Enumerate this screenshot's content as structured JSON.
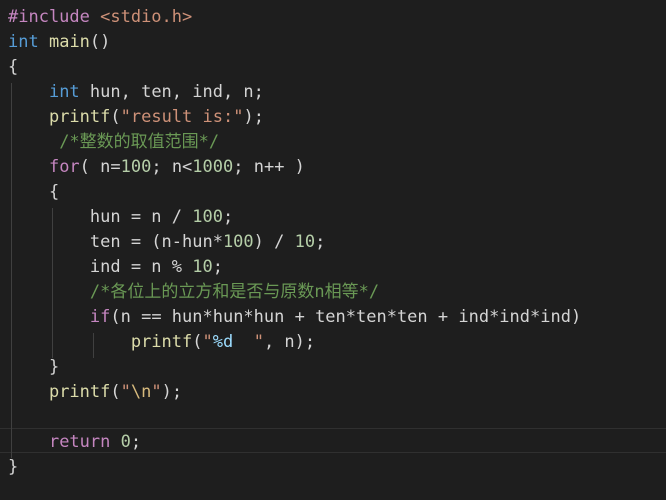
{
  "editor": {
    "theme": "dark",
    "background": "#1e1e1e",
    "colors": {
      "preprocessor": "#c586c0",
      "keyword_type": "#569cd6",
      "keyword_control": "#c586c0",
      "function": "#dcdcaa",
      "string": "#ce9178",
      "number": "#b5cea8",
      "comment": "#6a9955",
      "text": "#d4d4d4"
    },
    "lines": [
      [
        {
          "t": "#include ",
          "c": "kw-pre"
        },
        {
          "t": "<stdio.h>",
          "c": "str"
        }
      ],
      [
        {
          "t": "int",
          "c": "kw-type"
        },
        {
          "t": " ",
          "c": "plain"
        },
        {
          "t": "main",
          "c": "fn"
        },
        {
          "t": "()",
          "c": "plain"
        }
      ],
      [
        {
          "t": "{",
          "c": "plain"
        }
      ],
      [
        {
          "t": "    ",
          "c": "plain"
        },
        {
          "t": "int",
          "c": "kw-type"
        },
        {
          "t": " hun, ten, ind, n;",
          "c": "plain"
        }
      ],
      [
        {
          "t": "    ",
          "c": "plain"
        },
        {
          "t": "printf",
          "c": "fn"
        },
        {
          "t": "(",
          "c": "plain"
        },
        {
          "t": "\"result is:\"",
          "c": "str"
        },
        {
          "t": ");",
          "c": "plain"
        }
      ],
      [
        {
          "t": "     ",
          "c": "plain"
        },
        {
          "t": "/*整数的取值范围*/",
          "c": "com"
        }
      ],
      [
        {
          "t": "    ",
          "c": "plain"
        },
        {
          "t": "for",
          "c": "kw-ctrl"
        },
        {
          "t": "( n=",
          "c": "plain"
        },
        {
          "t": "100",
          "c": "num"
        },
        {
          "t": "; n<",
          "c": "plain"
        },
        {
          "t": "1000",
          "c": "num"
        },
        {
          "t": "; n++ )",
          "c": "plain"
        }
      ],
      [
        {
          "t": "    {",
          "c": "plain"
        }
      ],
      [
        {
          "t": "        hun = n / ",
          "c": "plain"
        },
        {
          "t": "100",
          "c": "num"
        },
        {
          "t": ";",
          "c": "plain"
        }
      ],
      [
        {
          "t": "        ten = (n-hun*",
          "c": "plain"
        },
        {
          "t": "100",
          "c": "num"
        },
        {
          "t": ") / ",
          "c": "plain"
        },
        {
          "t": "10",
          "c": "num"
        },
        {
          "t": ";",
          "c": "plain"
        }
      ],
      [
        {
          "t": "        ind = n % ",
          "c": "plain"
        },
        {
          "t": "10",
          "c": "num"
        },
        {
          "t": ";",
          "c": "plain"
        }
      ],
      [
        {
          "t": "        ",
          "c": "plain"
        },
        {
          "t": "/*各位上的立方和是否与原数n相等*/",
          "c": "com"
        }
      ],
      [
        {
          "t": "        ",
          "c": "plain"
        },
        {
          "t": "if",
          "c": "kw-ctrl"
        },
        {
          "t": "(n == hun*hun*hun + ten*ten*ten + ind*ind*ind)",
          "c": "plain"
        }
      ],
      [
        {
          "t": "            ",
          "c": "plain"
        },
        {
          "t": "printf",
          "c": "fn"
        },
        {
          "t": "(",
          "c": "plain"
        },
        {
          "t": "\"",
          "c": "str"
        },
        {
          "t": "%d",
          "c": "fmt"
        },
        {
          "t": "  \"",
          "c": "str"
        },
        {
          "t": ", n);",
          "c": "plain"
        }
      ],
      [
        {
          "t": "    }",
          "c": "plain"
        }
      ],
      [
        {
          "t": "    ",
          "c": "plain"
        },
        {
          "t": "printf",
          "c": "fn"
        },
        {
          "t": "(",
          "c": "plain"
        },
        {
          "t": "\"",
          "c": "str"
        },
        {
          "t": "\\n",
          "c": "esc"
        },
        {
          "t": "\"",
          "c": "str"
        },
        {
          "t": ");",
          "c": "plain"
        }
      ],
      [
        {
          "t": "",
          "c": "plain"
        }
      ],
      [
        {
          "t": "    ",
          "c": "plain"
        },
        {
          "t": "return",
          "c": "kw-ctrl"
        },
        {
          "t": " ",
          "c": "plain"
        },
        {
          "t": "0",
          "c": "num"
        },
        {
          "t": ";",
          "c": "plain"
        }
      ],
      [
        {
          "t": "}",
          "c": "plain"
        }
      ]
    ]
  }
}
